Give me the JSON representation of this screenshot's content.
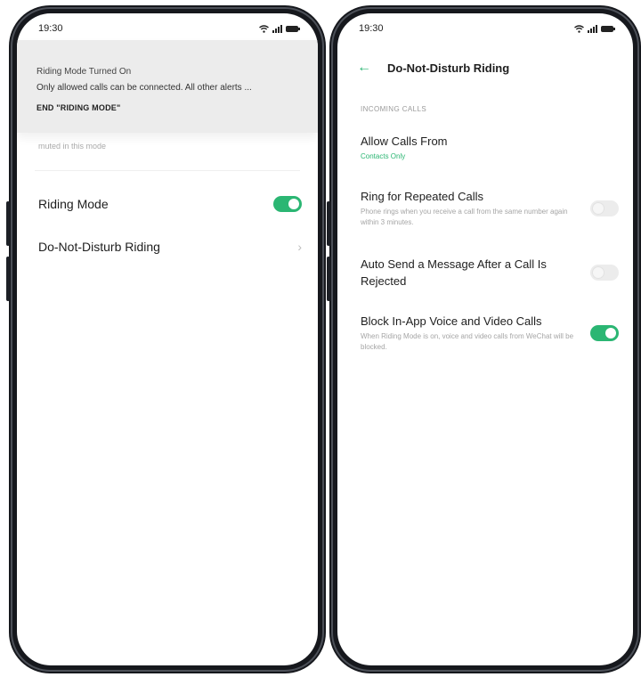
{
  "theme": {
    "accent": "#2bb673",
    "frame": "#16181d"
  },
  "left_phone": {
    "status_bar": {
      "time": "19:30",
      "icons": [
        "wifi-icon",
        "signal-icon",
        "battery-icon"
      ]
    },
    "notification": {
      "title": "Riding Mode Turned On",
      "text": "Only allowed calls can be connected. All other alerts ...",
      "action": "END \"RIDING MODE\""
    },
    "muted_text": "muted in this mode",
    "rows": [
      {
        "label": "Riding Mode",
        "control": "toggle",
        "state": "on"
      },
      {
        "label": "Do-Not-Disturb Riding",
        "control": "chevron"
      }
    ]
  },
  "right_phone": {
    "status_bar": {
      "time": "19:30",
      "icons": [
        "wifi-icon",
        "signal-icon",
        "battery-icon"
      ]
    },
    "header": {
      "title": "Do-Not-Disturb Riding",
      "back_icon": "back-arrow-icon"
    },
    "section_label": "INCOMING CALLS",
    "settings": [
      {
        "title": "Allow Calls From",
        "subtitle": "Contacts Only"
      },
      {
        "title": "Ring for Repeated Calls",
        "subtitle": "Phone rings when you receive a call from the same number again within 3 minutes.",
        "toggle": "off"
      },
      {
        "title": "Auto Send a Message After a Call Is Rejected",
        "toggle": "off"
      },
      {
        "title": "Block In-App Voice and Video Calls",
        "subtitle": "When Riding Mode is on, voice and video calls from WeChat will be blocked.",
        "toggle": "on"
      }
    ]
  }
}
